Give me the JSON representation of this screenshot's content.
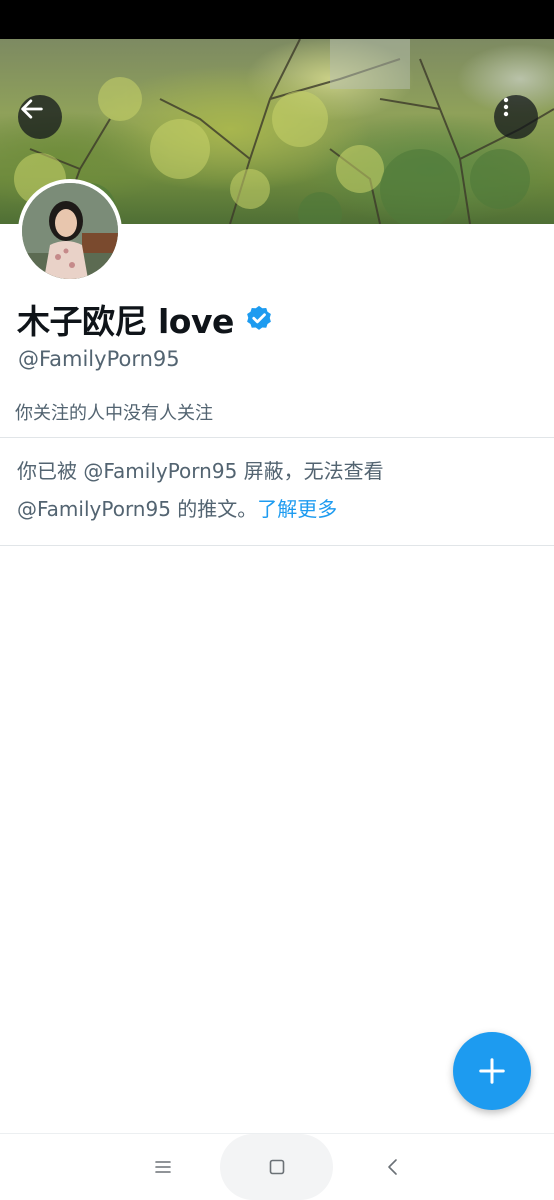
{
  "profile": {
    "display_name": "木子欧尼 love",
    "verified": true,
    "handle": "@FamilyPorn95",
    "followers_note": "你关注的人中没有人关注"
  },
  "blocked_notice": {
    "text": "你已被 @FamilyPorn95 屏蔽，无法查看 @FamilyPorn95 的推文。",
    "link_label": "了解更多"
  },
  "header": {
    "back_icon": "arrow-left-icon",
    "more_icon": "more-vertical-icon"
  },
  "fab": {
    "icon": "plus-icon"
  },
  "system_nav": {
    "menu_icon": "menu-icon",
    "home_icon": "home-square-icon",
    "back_icon": "chevron-left-icon"
  },
  "colors": {
    "accent": "#1d9bf0",
    "text_primary": "#0f1419",
    "text_secondary": "#536471",
    "divider": "#e1e5e8"
  }
}
